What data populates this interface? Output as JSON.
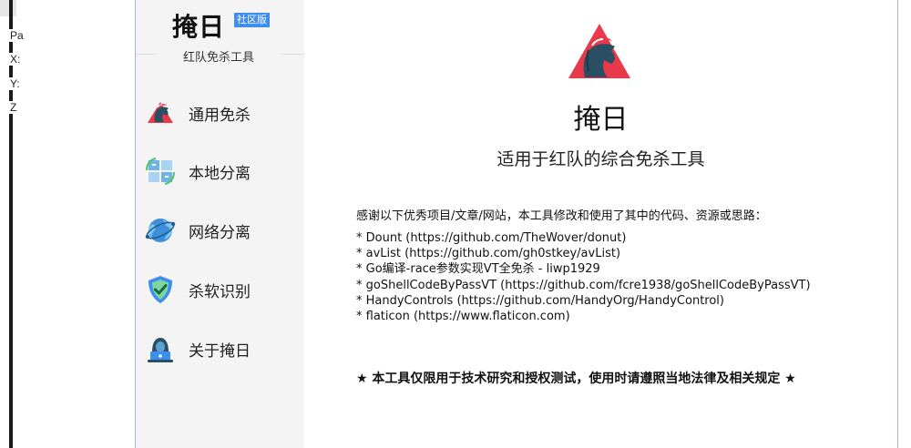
{
  "background_window": {
    "labels": [
      "Pa",
      "X:",
      "Y:",
      "Z"
    ]
  },
  "sidebar": {
    "brand": "掩日",
    "edition": "社区版",
    "subtitle": "红队免杀工具",
    "items": [
      {
        "label": "通用免杀",
        "icon": "horse-logo-icon"
      },
      {
        "label": "本地分离",
        "icon": "local-separation-icon"
      },
      {
        "label": "网络分离",
        "icon": "globe-network-icon"
      },
      {
        "label": "杀软识别",
        "icon": "shield-check-icon"
      },
      {
        "label": "关于掩日",
        "icon": "hacker-laptop-icon"
      }
    ]
  },
  "main": {
    "title": "掩日",
    "tagline": "适用于红队的综合免杀工具",
    "thanks_intro": "感谢以下优秀项目/文章/网站，本工具修改和使用了其中的代码、资源或思路：",
    "credits": [
      "* Dount (https://github.com/TheWover/donut)",
      "* avList (https://github.com/gh0stkey/avList)",
      "* Go编译-race参数实现VT全免杀 - liwp1929",
      "* goShellCodeByPassVT (https://github.com/fcre1938/goShellCodeByPassVT)",
      "* HandyControls (https://github.com/HandyOrg/HandyControl)",
      "* flaticon (https://www.flaticon.com)"
    ],
    "disclaimer": "★ 本工具仅限用于技术研究和授权测试，使用时请遵照当地法律及相关规定 ★"
  },
  "colors": {
    "accent": "#3d8ef0",
    "logo_red": "#e8394a",
    "logo_teal": "#2a4f63",
    "sidebar_bg": "#f4f4f4"
  }
}
